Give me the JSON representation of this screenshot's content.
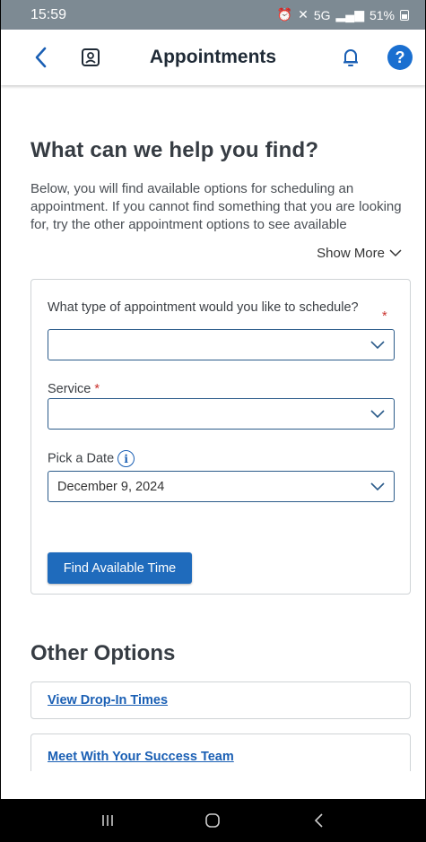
{
  "status_bar": {
    "time": "15:59",
    "network": "5G",
    "battery": "51%"
  },
  "header": {
    "title": "Appointments",
    "icons": [
      "back-chevron-icon",
      "profile-card-icon",
      "bell-icon",
      "help-icon"
    ],
    "help_glyph": "?"
  },
  "main": {
    "heading": "What can we help you find?",
    "intro": "Below, you will find available options for scheduling an appointment. If you cannot find something that you are looking for, try the other appointment options to see available",
    "show_more": "Show More"
  },
  "form": {
    "appointment_type_label": "What type of appointment would you like to schedule?",
    "appointment_type_value": "",
    "service_label": "Service",
    "service_value": "",
    "date_label": "Pick a Date",
    "date_value": "December 9, 2024",
    "required_mark": "*",
    "info_glyph": "i",
    "submit_label": "Find Available Time"
  },
  "other_options": {
    "heading": "Other Options",
    "items": [
      {
        "label": "View Drop-In Times"
      },
      {
        "label": "Meet With Your Success Team"
      }
    ]
  },
  "colors": {
    "status_bar": "#7d8a93",
    "accent": "#1f6bbc",
    "link": "#1a5fb4",
    "required": "#c9302c",
    "help_circle": "#1a6fd0"
  }
}
